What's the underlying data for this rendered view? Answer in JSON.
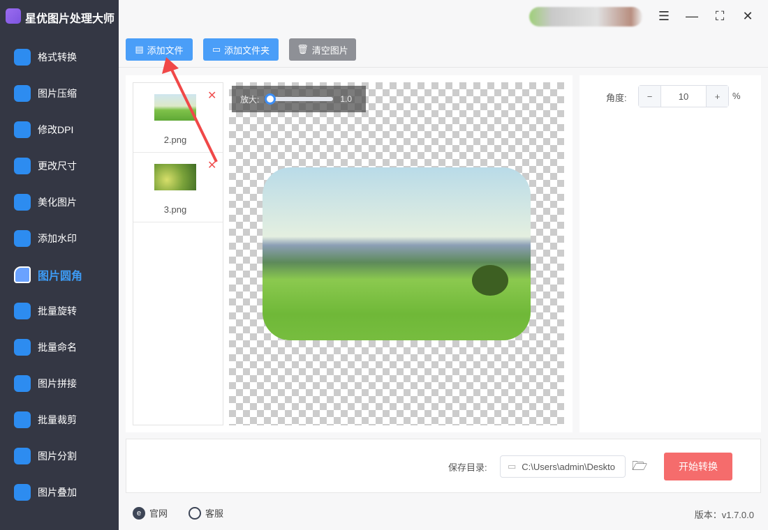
{
  "app": {
    "title": "星优图片处理大师"
  },
  "sidebar": {
    "items": [
      {
        "label": "格式转换",
        "icon": "image-convert-icon"
      },
      {
        "label": "图片压缩",
        "icon": "compress-icon"
      },
      {
        "label": "修改DPI",
        "icon": "dpi-icon"
      },
      {
        "label": "更改尺寸",
        "icon": "resize-icon"
      },
      {
        "label": "美化图片",
        "icon": "beautify-icon"
      },
      {
        "label": "添加水印",
        "icon": "watermark-icon"
      },
      {
        "label": "图片圆角",
        "icon": "round-corner-icon",
        "active": true
      },
      {
        "label": "批量旋转",
        "icon": "rotate-icon"
      },
      {
        "label": "批量命名",
        "icon": "rename-icon"
      },
      {
        "label": "图片拼接",
        "icon": "stitch-icon"
      },
      {
        "label": "批量裁剪",
        "icon": "crop-icon"
      },
      {
        "label": "图片分割",
        "icon": "split-icon"
      },
      {
        "label": "图片叠加",
        "icon": "overlay-icon"
      }
    ]
  },
  "toolbar": {
    "add_file": "添加文件",
    "add_folder": "添加文件夹",
    "clear": "清空图片"
  },
  "files": [
    {
      "name": "2.png"
    },
    {
      "name": "3.png"
    }
  ],
  "zoom": {
    "label": "放大:",
    "value": "1.0",
    "fraction": 0.0
  },
  "settings": {
    "angle_label": "角度:",
    "angle_value": "10",
    "unit": "%",
    "minus": "−",
    "plus": "+"
  },
  "save": {
    "label": "保存目录:",
    "path": "C:\\Users\\admin\\Deskto",
    "start": "开始转换"
  },
  "footer": {
    "website": "官网",
    "support": "客服",
    "version": "版本：v1.7.0.0"
  },
  "colors": {
    "primary": "#4a9ef8",
    "danger": "#f56c6c",
    "sidebar": "#343744"
  }
}
